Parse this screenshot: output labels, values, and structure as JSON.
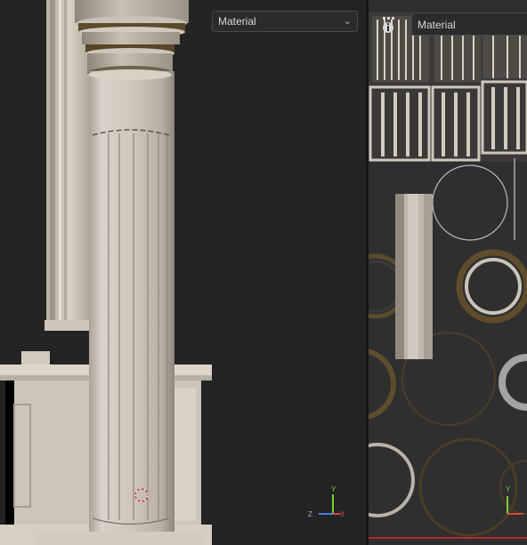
{
  "viewport": {
    "shading_dropdown": {
      "value": "Material"
    }
  },
  "uv_editor": {
    "shading_dropdown": {
      "value": "Material"
    }
  },
  "gizmo_left": {
    "x": "X",
    "y": "Y",
    "z": "Z"
  },
  "gizmo_right": {
    "y": "Y"
  },
  "colors": {
    "background": "#242424",
    "stone": "#cfc6bb",
    "axis_x": "#e0463b",
    "axis_y": "#7bcf3a",
    "axis_z": "#4a7fe0"
  }
}
